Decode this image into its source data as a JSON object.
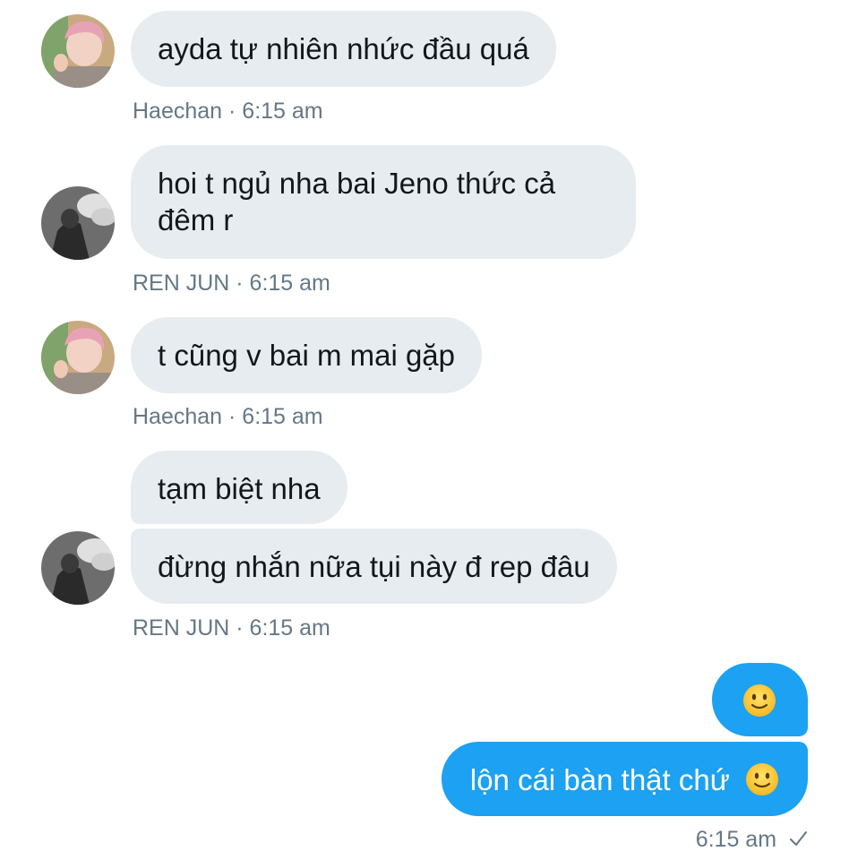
{
  "messages": [
    {
      "sender": "Haechan",
      "text": "ayda tự nhiên nhức đầu quá",
      "time": "6:15 am"
    },
    {
      "sender": "REN JUN",
      "text": "hoi t ngủ nha bai Jeno thức cả đêm r",
      "time": "6:15 am"
    },
    {
      "sender": "Haechan",
      "text": "t cũng v bai m mai gặp",
      "time": "6:15 am"
    },
    {
      "sender": "REN JUN",
      "text": "tạm biệt nha",
      "time": ""
    },
    {
      "sender": "REN JUN",
      "text": "đừng nhắn nữa tụi này đ rep đâu",
      "time": "6:15 am"
    }
  ],
  "outgoing": [
    {
      "text": "",
      "emoji": "slightly-smiling-face"
    },
    {
      "text": "lộn cái bàn thật chứ",
      "emoji": "slightly-smiling-face"
    }
  ],
  "meta": {
    "m1": "Haechan · 6:15 am",
    "m2": "REN JUN · 6:15 am",
    "m3": "Haechan · 6:15 am",
    "m5": "REN JUN · 6:15 am",
    "out_time": "6:15 am",
    "read_icon": "checkmark-icon"
  },
  "colors": {
    "incoming_bubble": "#e6ecf0",
    "outgoing_bubble": "#1da1f2",
    "meta_text": "#657786"
  }
}
